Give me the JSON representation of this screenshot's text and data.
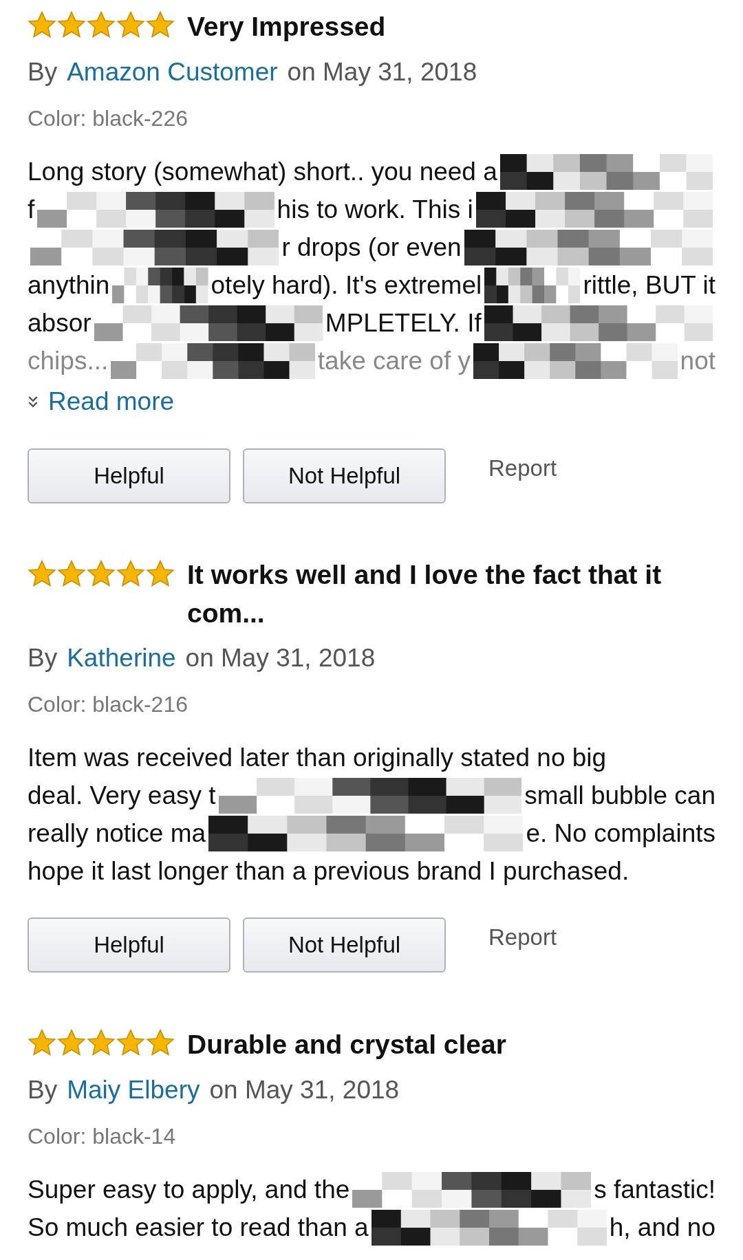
{
  "reviews": [
    {
      "stars": 5,
      "title": "Very Impressed",
      "by": "By",
      "author": "Amazon Customer",
      "date": "on May 31, 2018",
      "variant": "Color: black-226",
      "body": [
        {
          "faded": false,
          "segments": [
            {
              "kind": "text",
              "text": "Long story (somewhat) short.. you need a"
            },
            {
              "kind": "mosaic"
            }
          ]
        },
        {
          "faded": false,
          "segments": [
            {
              "kind": "text",
              "text": "f"
            },
            {
              "kind": "mosaic"
            },
            {
              "kind": "text",
              "text": "his to work. This i"
            },
            {
              "kind": "mosaic"
            }
          ]
        },
        {
          "faded": false,
          "segments": [
            {
              "kind": "mosaic"
            },
            {
              "kind": "text",
              "text": "r drops (or even"
            },
            {
              "kind": "mosaic"
            }
          ]
        },
        {
          "faded": false,
          "segments": [
            {
              "kind": "text",
              "text": "anythin"
            },
            {
              "kind": "mosaic"
            },
            {
              "kind": "text",
              "text": "otely hard). It's extremel"
            },
            {
              "kind": "mosaic"
            },
            {
              "kind": "text",
              "text": "rittle, BUT it"
            }
          ]
        },
        {
          "faded": false,
          "segments": [
            {
              "kind": "text",
              "text": "absor"
            },
            {
              "kind": "mosaic"
            },
            {
              "kind": "text",
              "text": "MPLETELY. If"
            },
            {
              "kind": "mosaic"
            }
          ]
        },
        {
          "faded": true,
          "segments": [
            {
              "kind": "text",
              "text": "chips..."
            },
            {
              "kind": "mosaic"
            },
            {
              "kind": "text",
              "text": "take care of y"
            },
            {
              "kind": "mosaic"
            },
            {
              "kind": "text",
              "text": "not"
            }
          ]
        }
      ],
      "read_more": "Read more",
      "helpful": "Helpful",
      "not_helpful": "Not Helpful",
      "report": "Report"
    },
    {
      "stars": 5,
      "title": "It works well and I love the fact that it com...",
      "by": "By",
      "author": "Katherine",
      "date": "on May 31, 2018",
      "variant": "Color: black-216",
      "body": [
        {
          "faded": false,
          "segments": [
            {
              "kind": "text",
              "text": "Item was received later than originally stated no big"
            }
          ]
        },
        {
          "faded": false,
          "segments": [
            {
              "kind": "text",
              "text": "deal. Very easy t"
            },
            {
              "kind": "mosaic"
            },
            {
              "kind": "text",
              "text": "small bubble can"
            }
          ]
        },
        {
          "faded": false,
          "segments": [
            {
              "kind": "text",
              "text": "really notice ma"
            },
            {
              "kind": "mosaic"
            },
            {
              "kind": "text",
              "text": "e. No complaints"
            }
          ]
        },
        {
          "faded": false,
          "segments": [
            {
              "kind": "text",
              "text": "hope it last longer than a previous brand I purchased."
            }
          ]
        }
      ],
      "helpful": "Helpful",
      "not_helpful": "Not Helpful",
      "report": "Report"
    },
    {
      "stars": 5,
      "title": "Durable and crystal clear",
      "by": "By",
      "author": "Maiy Elbery",
      "date": "on May 31, 2018",
      "variant": "Color: black-14",
      "body": [
        {
          "faded": false,
          "segments": [
            {
              "kind": "text",
              "text": "Super easy to apply, and the"
            },
            {
              "kind": "mosaic"
            },
            {
              "kind": "text",
              "text": "s fantastic!"
            }
          ]
        },
        {
          "faded": false,
          "segments": [
            {
              "kind": "text",
              "text": "So much easier to read than a"
            },
            {
              "kind": "mosaic"
            },
            {
              "kind": "text",
              "text": "h, and no"
            }
          ]
        }
      ]
    }
  ]
}
